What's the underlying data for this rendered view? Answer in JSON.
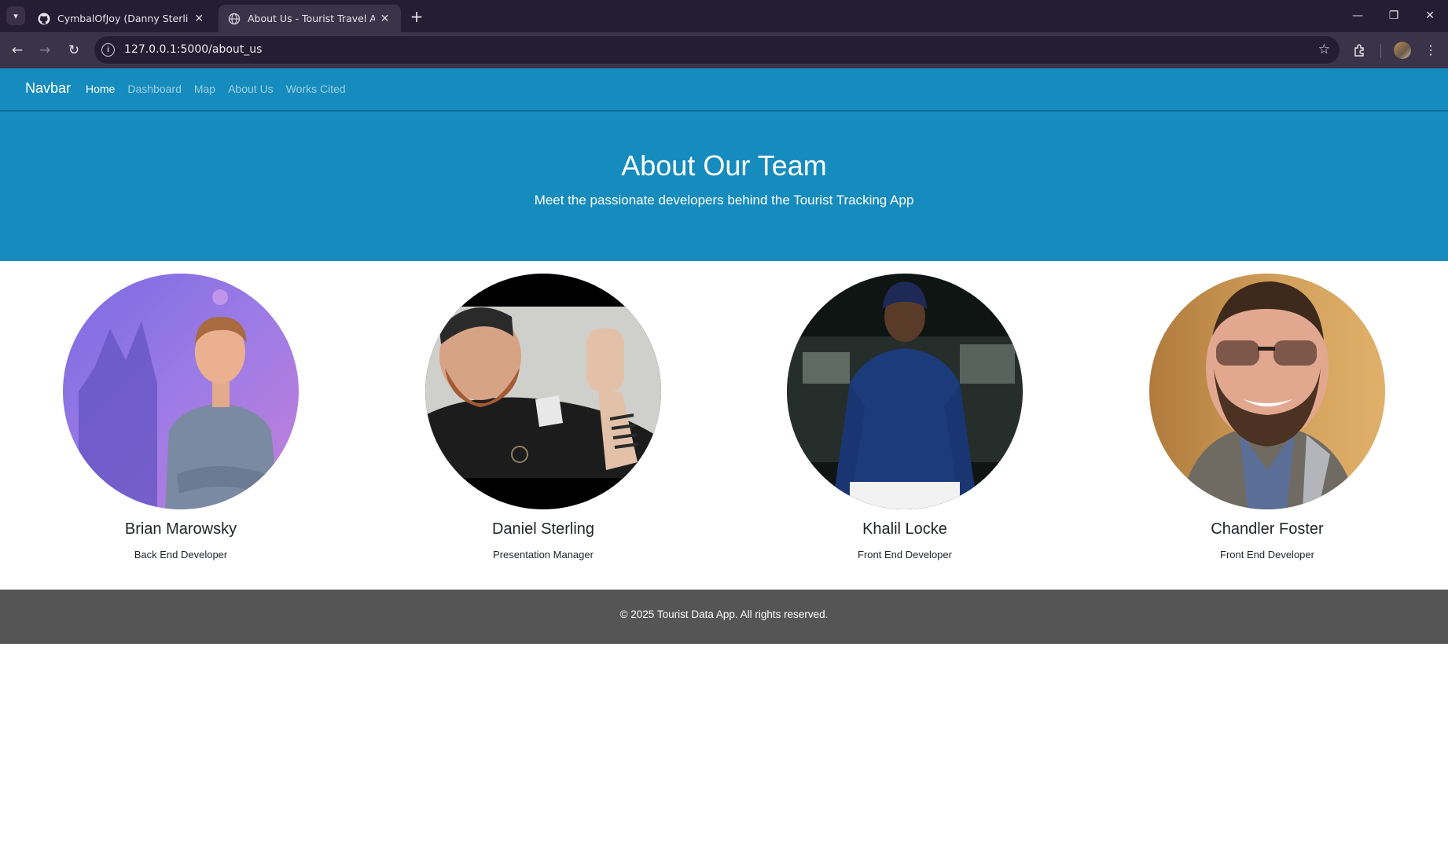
{
  "browser": {
    "tabs": [
      {
        "title": "CymbalOfJoy (Danny Sterling)",
        "icon": "github-icon"
      },
      {
        "title": "About Us - Tourist Travel App",
        "icon": "globe-icon",
        "active": true
      }
    ],
    "url": "127.0.0.1:5000/about_us"
  },
  "navbar": {
    "brand": "Navbar",
    "links": [
      "Home",
      "Dashboard",
      "Map",
      "About Us",
      "Works Cited"
    ],
    "active": "Home",
    "color": "#168bbd"
  },
  "hero": {
    "title": "About Our Team",
    "subtitle": "Meet the passionate developers behind the Tourist Tracking App"
  },
  "team": [
    {
      "name": "Brian Marowsky",
      "role": "Back End Developer"
    },
    {
      "name": "Daniel Sterling",
      "role": "Presentation Manager"
    },
    {
      "name": "Khalil Locke",
      "role": "Front End Developer"
    },
    {
      "name": "Chandler Foster",
      "role": "Front End Developer"
    }
  ],
  "footer": {
    "text": "© 2025 Tourist Data App. All rights reserved.",
    "color": "#555555"
  }
}
